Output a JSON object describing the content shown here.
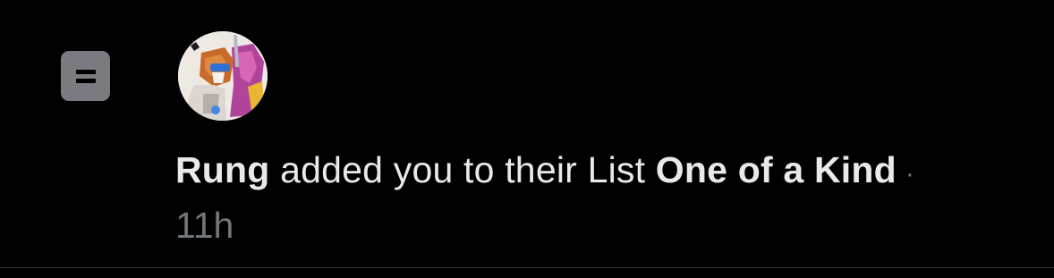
{
  "notification": {
    "type_icon": "list-icon",
    "avatar_icon": "user-avatar",
    "user_name": "Rung",
    "action_text": " added you to their List ",
    "list_name": "One of a Kind",
    "separator": "·",
    "timestamp": "11h"
  },
  "colors": {
    "background": "#000000",
    "primary_text": "#e7e9ea",
    "secondary_text": "#71767b",
    "icon_badge": "#7a7a80",
    "divider": "#2f3336"
  }
}
